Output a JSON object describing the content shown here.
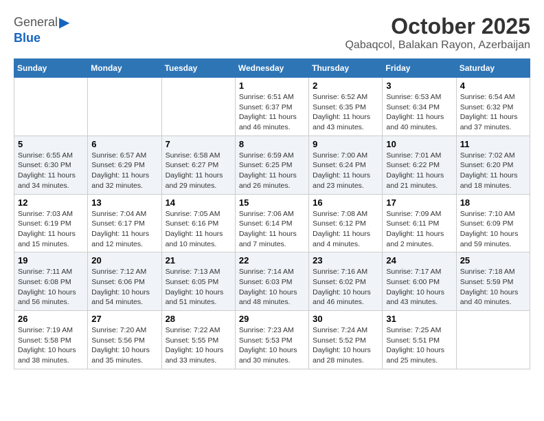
{
  "header": {
    "logo_general": "General",
    "logo_blue": "Blue",
    "month": "October 2025",
    "location": "Qabaqcol, Balakan Rayon, Azerbaijan"
  },
  "weekdays": [
    "Sunday",
    "Monday",
    "Tuesday",
    "Wednesday",
    "Thursday",
    "Friday",
    "Saturday"
  ],
  "weeks": [
    [
      {
        "day": "",
        "info": ""
      },
      {
        "day": "",
        "info": ""
      },
      {
        "day": "",
        "info": ""
      },
      {
        "day": "1",
        "info": "Sunrise: 6:51 AM\nSunset: 6:37 PM\nDaylight: 11 hours\nand 46 minutes."
      },
      {
        "day": "2",
        "info": "Sunrise: 6:52 AM\nSunset: 6:35 PM\nDaylight: 11 hours\nand 43 minutes."
      },
      {
        "day": "3",
        "info": "Sunrise: 6:53 AM\nSunset: 6:34 PM\nDaylight: 11 hours\nand 40 minutes."
      },
      {
        "day": "4",
        "info": "Sunrise: 6:54 AM\nSunset: 6:32 PM\nDaylight: 11 hours\nand 37 minutes."
      }
    ],
    [
      {
        "day": "5",
        "info": "Sunrise: 6:55 AM\nSunset: 6:30 PM\nDaylight: 11 hours\nand 34 minutes."
      },
      {
        "day": "6",
        "info": "Sunrise: 6:57 AM\nSunset: 6:29 PM\nDaylight: 11 hours\nand 32 minutes."
      },
      {
        "day": "7",
        "info": "Sunrise: 6:58 AM\nSunset: 6:27 PM\nDaylight: 11 hours\nand 29 minutes."
      },
      {
        "day": "8",
        "info": "Sunrise: 6:59 AM\nSunset: 6:25 PM\nDaylight: 11 hours\nand 26 minutes."
      },
      {
        "day": "9",
        "info": "Sunrise: 7:00 AM\nSunset: 6:24 PM\nDaylight: 11 hours\nand 23 minutes."
      },
      {
        "day": "10",
        "info": "Sunrise: 7:01 AM\nSunset: 6:22 PM\nDaylight: 11 hours\nand 21 minutes."
      },
      {
        "day": "11",
        "info": "Sunrise: 7:02 AM\nSunset: 6:20 PM\nDaylight: 11 hours\nand 18 minutes."
      }
    ],
    [
      {
        "day": "12",
        "info": "Sunrise: 7:03 AM\nSunset: 6:19 PM\nDaylight: 11 hours\nand 15 minutes."
      },
      {
        "day": "13",
        "info": "Sunrise: 7:04 AM\nSunset: 6:17 PM\nDaylight: 11 hours\nand 12 minutes."
      },
      {
        "day": "14",
        "info": "Sunrise: 7:05 AM\nSunset: 6:16 PM\nDaylight: 11 hours\nand 10 minutes."
      },
      {
        "day": "15",
        "info": "Sunrise: 7:06 AM\nSunset: 6:14 PM\nDaylight: 11 hours\nand 7 minutes."
      },
      {
        "day": "16",
        "info": "Sunrise: 7:08 AM\nSunset: 6:12 PM\nDaylight: 11 hours\nand 4 minutes."
      },
      {
        "day": "17",
        "info": "Sunrise: 7:09 AM\nSunset: 6:11 PM\nDaylight: 11 hours\nand 2 minutes."
      },
      {
        "day": "18",
        "info": "Sunrise: 7:10 AM\nSunset: 6:09 PM\nDaylight: 10 hours\nand 59 minutes."
      }
    ],
    [
      {
        "day": "19",
        "info": "Sunrise: 7:11 AM\nSunset: 6:08 PM\nDaylight: 10 hours\nand 56 minutes."
      },
      {
        "day": "20",
        "info": "Sunrise: 7:12 AM\nSunset: 6:06 PM\nDaylight: 10 hours\nand 54 minutes."
      },
      {
        "day": "21",
        "info": "Sunrise: 7:13 AM\nSunset: 6:05 PM\nDaylight: 10 hours\nand 51 minutes."
      },
      {
        "day": "22",
        "info": "Sunrise: 7:14 AM\nSunset: 6:03 PM\nDaylight: 10 hours\nand 48 minutes."
      },
      {
        "day": "23",
        "info": "Sunrise: 7:16 AM\nSunset: 6:02 PM\nDaylight: 10 hours\nand 46 minutes."
      },
      {
        "day": "24",
        "info": "Sunrise: 7:17 AM\nSunset: 6:00 PM\nDaylight: 10 hours\nand 43 minutes."
      },
      {
        "day": "25",
        "info": "Sunrise: 7:18 AM\nSunset: 5:59 PM\nDaylight: 10 hours\nand 40 minutes."
      }
    ],
    [
      {
        "day": "26",
        "info": "Sunrise: 7:19 AM\nSunset: 5:58 PM\nDaylight: 10 hours\nand 38 minutes."
      },
      {
        "day": "27",
        "info": "Sunrise: 7:20 AM\nSunset: 5:56 PM\nDaylight: 10 hours\nand 35 minutes."
      },
      {
        "day": "28",
        "info": "Sunrise: 7:22 AM\nSunset: 5:55 PM\nDaylight: 10 hours\nand 33 minutes."
      },
      {
        "day": "29",
        "info": "Sunrise: 7:23 AM\nSunset: 5:53 PM\nDaylight: 10 hours\nand 30 minutes."
      },
      {
        "day": "30",
        "info": "Sunrise: 7:24 AM\nSunset: 5:52 PM\nDaylight: 10 hours\nand 28 minutes."
      },
      {
        "day": "31",
        "info": "Sunrise: 7:25 AM\nSunset: 5:51 PM\nDaylight: 10 hours\nand 25 minutes."
      },
      {
        "day": "",
        "info": ""
      }
    ]
  ]
}
